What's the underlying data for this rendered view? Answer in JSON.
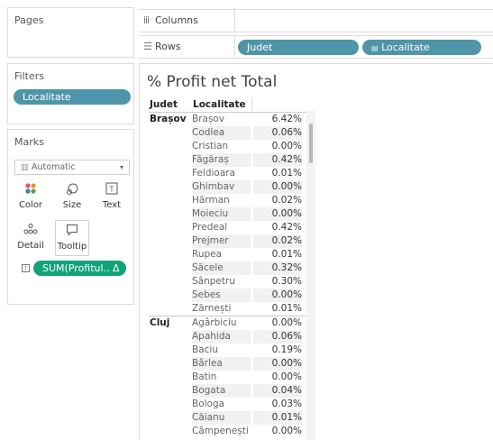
{
  "panels": {
    "pages_title": "Pages",
    "filters_title": "Filters",
    "marks_title": "Marks"
  },
  "filters": {
    "pill": "Localitate"
  },
  "shelves": {
    "columns_label": "Columns",
    "rows_label": "Rows",
    "rows_pills": [
      "Judet",
      "Localitate"
    ]
  },
  "marks": {
    "mark_type": "Automatic",
    "buttons": {
      "color": "Color",
      "size": "Size",
      "text": "Text",
      "detail": "Detail",
      "tooltip": "Tooltip"
    },
    "field_pill": "SUM(Profitul.. Δ",
    "colors": {
      "teal": "#4f95aa",
      "green": "#12a37a"
    }
  },
  "view": {
    "title": "% Profit net Total",
    "headers": {
      "judet": "Judet",
      "localitate": "Localitate"
    },
    "groups": [
      {
        "judet": "Brașov",
        "rows": [
          {
            "loc": "Brașov",
            "val": "6.42%"
          },
          {
            "loc": "Codlea",
            "val": "0.06%"
          },
          {
            "loc": "Cristian",
            "val": "0.00%"
          },
          {
            "loc": "Făgăraș",
            "val": "0.42%"
          },
          {
            "loc": "Feldioara",
            "val": "0.01%"
          },
          {
            "loc": "Ghimbav",
            "val": "0.00%"
          },
          {
            "loc": "Hărman",
            "val": "0.02%"
          },
          {
            "loc": "Moieciu",
            "val": "0.00%"
          },
          {
            "loc": "Predeal",
            "val": "0.42%"
          },
          {
            "loc": "Prejmer",
            "val": "0.02%"
          },
          {
            "loc": "Rupea",
            "val": "0.01%"
          },
          {
            "loc": "Săcele",
            "val": "0.32%"
          },
          {
            "loc": "Sânpetru",
            "val": "0.30%"
          },
          {
            "loc": "Sebes",
            "val": "0.00%"
          },
          {
            "loc": "Zărnești",
            "val": "0.01%"
          }
        ]
      },
      {
        "judet": "Cluj",
        "rows": [
          {
            "loc": "Agârbiciu",
            "val": "0.00%"
          },
          {
            "loc": "Apahida",
            "val": "0.06%"
          },
          {
            "loc": "Baciu",
            "val": "0.19%"
          },
          {
            "loc": "Bârlea",
            "val": "0.00%"
          },
          {
            "loc": "Batin",
            "val": "0.00%"
          },
          {
            "loc": "Bogata",
            "val": "0.04%"
          },
          {
            "loc": "Bologa",
            "val": "0.03%"
          },
          {
            "loc": "Căianu",
            "val": "0.01%"
          },
          {
            "loc": "Câmpenești",
            "val": "0.00%"
          }
        ]
      }
    ]
  }
}
